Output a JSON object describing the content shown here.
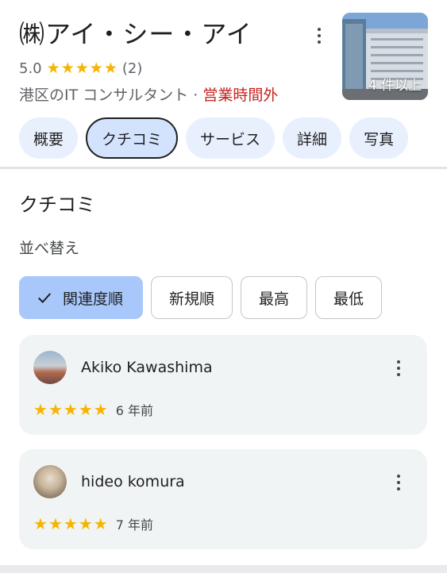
{
  "place": {
    "name": "㈱アイ・シー・アイ",
    "rating": "5.0",
    "stars": 5,
    "review_count": "(2)",
    "category": "港区のIT コンサルタント",
    "separator": " · ",
    "status": "営業時間外",
    "photo_count": "4 件以上"
  },
  "tabs": [
    {
      "label": "概要"
    },
    {
      "label": "クチコミ",
      "active": true
    },
    {
      "label": "サービス"
    },
    {
      "label": "詳細"
    },
    {
      "label": "写真"
    }
  ],
  "reviews_section": {
    "title": "クチコミ",
    "sort_label": "並べ替え",
    "sort_options": [
      {
        "label": "関連度順",
        "selected": true
      },
      {
        "label": "新規順"
      },
      {
        "label": "最高"
      },
      {
        "label": "最低"
      }
    ]
  },
  "reviews": [
    {
      "name": "Akiko Kawashima",
      "stars": 5,
      "time": "6 年前"
    },
    {
      "name": "hideo komura",
      "stars": 5,
      "time": "7 年前"
    }
  ],
  "colors": {
    "star": "#f4b400",
    "closed": "#c5221f",
    "tab_bg": "#e8f0fe",
    "selected_chip": "#a8c7fa"
  },
  "icons": {
    "more": "more-vert-icon",
    "check": "check-icon",
    "star": "star-icon"
  }
}
